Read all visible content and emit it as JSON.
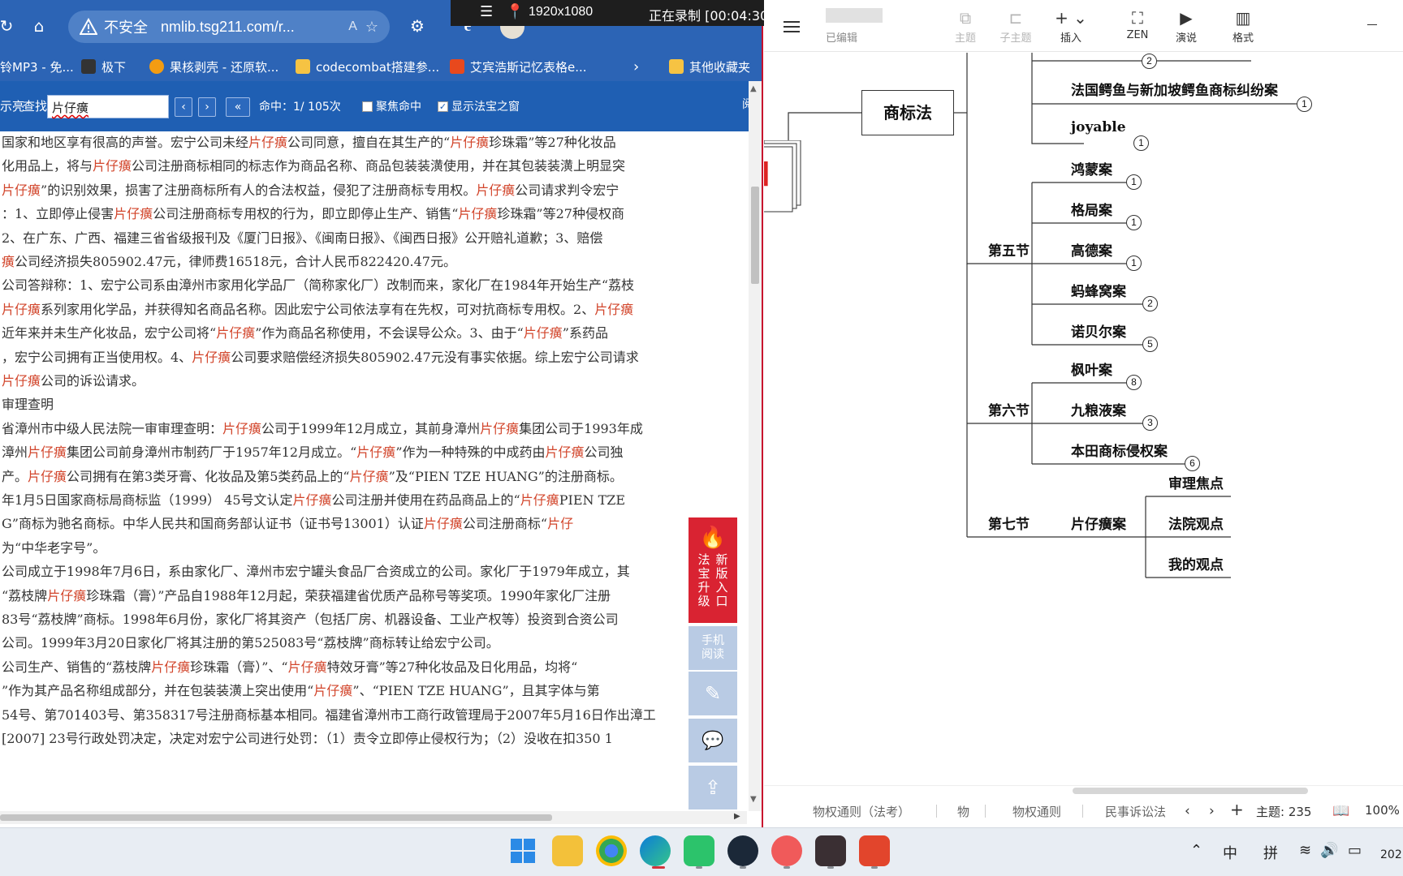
{
  "recorder": {
    "resolution": "1920x1080",
    "status": "正在录制 [00:04:30]"
  },
  "browser": {
    "address": {
      "security": "不安全",
      "url": "nmlib.tsg211.com/r...",
      "read_aloud": "A"
    },
    "bookmarks": [
      {
        "label": "铃MP3 - 免...",
        "color": "#ffffff"
      },
      {
        "label": "极下",
        "color": "#333333"
      },
      {
        "label": "果核剥壳 - 还原软...",
        "color": "#f39c12"
      },
      {
        "label": "codecombat搭建参...",
        "color": "#f6c343"
      },
      {
        "label": "艾宾浩斯记忆表格e...",
        "color": "#e8491d"
      },
      {
        "label": "其他收藏夹",
        "color": "#f6c343"
      }
    ],
    "find": {
      "left_label": "示亮",
      "find_label": "查找",
      "query": "片仔癀",
      "hits": "命中：1/ 105次",
      "focus_hit": "聚焦命中",
      "show_window": "显示法宝之窗",
      "focus_checked": false,
      "show_checked": true
    },
    "lines": [
      [
        [
          "国家和地区享有很高的声誉。宏宁公司未经",
          0
        ],
        [
          "片仔癀",
          1
        ],
        [
          "公司同意，擅自在其生产的“",
          0
        ],
        [
          "片仔癀",
          1
        ],
        [
          "珍珠霜”等27种化妆品",
          0
        ]
      ],
      [
        [
          "化用品上，将与",
          0
        ],
        [
          "片仔癀",
          1
        ],
        [
          "公司注册商标相同的标志作为商品名称、商品包装装潢使用，并在其包装装潢上明显突",
          0
        ]
      ],
      [
        [
          "片仔癀",
          1
        ],
        [
          "”的识别效果，损害了注册商标所有人的合法权益，侵犯了注册商标专用权。",
          0
        ],
        [
          "片仔癀",
          1
        ],
        [
          "公司请求判令宏宁",
          0
        ]
      ],
      [
        [
          "：1、立即停止侵害",
          0
        ],
        [
          "片仔癀",
          1
        ],
        [
          "公司注册商标专用权的行为，即立即停止生产、销售“",
          0
        ],
        [
          "片仔癀",
          1
        ],
        [
          "珍珠霜”等27种侵权商",
          0
        ]
      ],
      [
        [
          "2、在广东、广西、福建三省省级报刊及《厦门日报》、《闽南日报》、《闽西日报》公开赔礼道歉；3、赔偿",
          0
        ]
      ],
      [
        [
          "癀",
          1
        ],
        [
          "公司经济损失805902.47元，律师费16518元，合计人民币822420.47元。",
          0
        ]
      ],
      [
        [
          "公司答辩称：1、宏宁公司系由漳州市家用化学品厂（简称家化厂）改制而来，家化厂在1984年开始生产“荔枝",
          0
        ]
      ],
      [
        [
          "片仔癀",
          1
        ],
        [
          "系列家用化学品，并获得知名商品名称。因此宏宁公司依法享有在先权，可对抗商标专用权。2、",
          0
        ],
        [
          "片仔癀",
          1
        ]
      ],
      [
        [
          "近年来并未生产化妆品，宏宁公司将“",
          0
        ],
        [
          "片仔癀",
          1
        ],
        [
          "”作为商品名称使用，不会误导公众。3、由于“",
          0
        ],
        [
          "片仔癀",
          1
        ],
        [
          "”系药品",
          0
        ]
      ],
      [
        [
          "，宏宁公司拥有正当使用权。4、",
          0
        ],
        [
          "片仔癀",
          1
        ],
        [
          "公司要求赔偿经济损失805902.47元没有事实依据。综上宏宁公司请求",
          0
        ]
      ],
      [
        [
          "片仔癀",
          1
        ],
        [
          "公司的诉讼请求。",
          0
        ]
      ],
      [
        [
          "审理查明",
          0
        ]
      ],
      [
        [
          "省漳州市中级人民法院一审审理查明：",
          0
        ],
        [
          "片仔癀",
          1
        ],
        [
          "公司于1999年12月成立，其前身漳州",
          0
        ],
        [
          "片仔癀",
          1
        ],
        [
          "集团公司于1993年成",
          0
        ]
      ],
      [
        [
          "漳州",
          0
        ],
        [
          "片仔癀",
          1
        ],
        [
          "集团公司前身漳州市制药厂于1957年12月成立。“",
          0
        ],
        [
          "片仔癀",
          1
        ],
        [
          "”作为一种特殊的中成药由",
          0
        ],
        [
          "片仔癀",
          1
        ],
        [
          "公司独",
          0
        ]
      ],
      [
        [
          "产。",
          0
        ],
        [
          "片仔癀",
          1
        ],
        [
          "公司拥有在第3类牙膏、化妆品及第5类药品上的“",
          0
        ],
        [
          "片仔癀",
          1
        ],
        [
          "”及“PIEN TZE HUANG”的注册商标。",
          0
        ]
      ],
      [
        [
          "年1月5日国家商标局商标监（1999） 45号文认定",
          0
        ],
        [
          "片仔癀",
          1
        ],
        [
          "公司注册并使用在药品商品上的“",
          0
        ],
        [
          "片仔癀",
          1
        ],
        [
          "PIEN TZE",
          0
        ]
      ],
      [
        [
          "G”商标为驰名商标。中华人民共和国商务部认证书（证书号13001）认证",
          0
        ],
        [
          "片仔癀",
          1
        ],
        [
          "公司注册商标“",
          0
        ],
        [
          "片仔",
          1
        ]
      ],
      [
        [
          "为“中华老字号”。",
          0
        ]
      ],
      [
        [
          "公司成立于1998年7月6日，系由家化厂、漳州市宏宁罐头食品厂合资成立的公司。家化厂于1979年成立，其",
          0
        ]
      ],
      [
        [
          "“荔枝牌",
          0
        ],
        [
          "片仔癀",
          1
        ],
        [
          "珍珠霜（膏）”产品自1988年12月起，荣获福建省优质产品称号等奖项。1990年家化厂注册",
          0
        ]
      ],
      [
        [
          "83号“荔枝牌”商标。1998年6月份，家化厂将其资产（包括厂房、机器设备、工业产权等）投资到合资公司",
          0
        ]
      ],
      [
        [
          "公司。1999年3月20日家化厂将其注册的第525083号“荔枝牌”商标转让给宏宁公司。",
          0
        ]
      ],
      [
        [
          "公司生产、销售的“荔枝牌",
          0
        ],
        [
          "片仔癀",
          1
        ],
        [
          "珍珠霜（膏）”、“",
          0
        ],
        [
          "片仔癀",
          1
        ],
        [
          "特效牙膏”等27种化妆品及日化用品，均将“",
          0
        ]
      ],
      [
        [
          "”作为其产品名称组成部分，并在包装装潢上突出使用“",
          0
        ],
        [
          "片仔癀",
          1
        ],
        [
          "”、“PIEN TZE HUANG”，且其字体与第",
          0
        ]
      ],
      [
        [
          "54号、第701403号、第358317号注册商标基本相同。福建省漳州市工商行政管理局于2007年5月16日作出漳工",
          0
        ]
      ],
      [
        [
          "[2007] 23号行政处罚决定，决定对宏宁公司进行处罚：（1）责令立即停止侵权行为；（2）没收在扣350 1",
          0
        ]
      ]
    ],
    "side": {
      "fabao_col1": "法宝升级",
      "fabao_col2": "新版入口",
      "mobile": "手机阅读"
    }
  },
  "mindmap": {
    "edited": "已编辑",
    "toolbar": [
      {
        "label": "主题",
        "glyph": "⧉",
        "disabled": true
      },
      {
        "label": "子主题",
        "glyph": "⊏",
        "disabled": true
      },
      {
        "label": "插入",
        "glyph": "+ ⌄",
        "disabled": false
      },
      {
        "label": "ZEN",
        "glyph": "⛶",
        "disabled": false
      },
      {
        "label": "演说",
        "glyph": "▶",
        "disabled": false
      },
      {
        "label": "格式",
        "glyph": "▥",
        "disabled": false
      }
    ],
    "root": "商标法",
    "top_badge": "2",
    "nodes": {
      "fr_case": "法国鳄鱼与新加坡鳄鱼商标纠纷案",
      "fr_badge": "1",
      "joyable": "joyable",
      "joyable_badge": "1",
      "s5": "第五节",
      "s5_items": [
        {
          "label": "鸿蒙案",
          "badge": "1"
        },
        {
          "label": "格局案",
          "badge": "1"
        },
        {
          "label": "高德案",
          "badge": "1"
        },
        {
          "label": "蚂蜂窝案",
          "badge": "2"
        },
        {
          "label": "诺贝尔案",
          "badge": "5"
        }
      ],
      "s6": "第六节",
      "s6_items": [
        {
          "label": "枫叶案",
          "badge": "8"
        },
        {
          "label": "九粮液案",
          "badge": "3"
        },
        {
          "label": "本田商标侵权案",
          "badge": "6"
        }
      ],
      "s7": "第七节",
      "s7_case": "片仔癀案",
      "s7_items": [
        "审理焦点",
        "法院观点",
        "我的观点"
      ]
    },
    "tabs": [
      "物权通则（法考）",
      "物",
      "物权通则",
      "民事诉讼法"
    ],
    "topic_count": "主题: 235",
    "zoom": "100%"
  },
  "taskbar": {
    "ime_lang": "中",
    "ime_mode": "拼",
    "clock": "202"
  }
}
